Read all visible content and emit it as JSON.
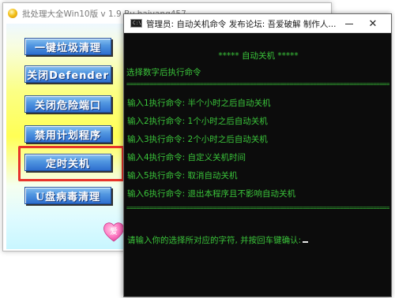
{
  "app_window": {
    "title": "批处理大全Win10版 v 1.9  By haiyang457",
    "buttons": [
      {
        "label": "一键垃圾清理"
      },
      {
        "label": "关闭Defender"
      },
      {
        "label": "关闭危险端口"
      },
      {
        "label": "禁用计划程序"
      },
      {
        "label": "定时关机"
      },
      {
        "label": "U盘病毒清理"
      }
    ],
    "highlighted_button": "定时关机",
    "highlight_color": "#e8332a",
    "heart_badge_text": "爱"
  },
  "console_window": {
    "title": "管理员:  自动关机命令    发布论坛: 吾爱破解      制作人...",
    "text_color": "#3ac43a",
    "background": "#0c0c0c",
    "header": "***** 自动关机 *****",
    "prompt": "选择数字后执行命令",
    "separator": "====================================================================================",
    "options": [
      "输入1执行命令: 半个小时之后自动关机",
      "输入2执行命令: 1个小时之后自动关机",
      "输入3执行命令: 2个小时之后自动关机",
      "输入4执行命令: 自定义关机时间",
      "输入5执行命令: 取消自动关机",
      "输入6执行命令: 退出本程序且不影响自动关机"
    ],
    "input_prompt": "请输入你的选择所对应的字符, 并按回车键确认:"
  }
}
